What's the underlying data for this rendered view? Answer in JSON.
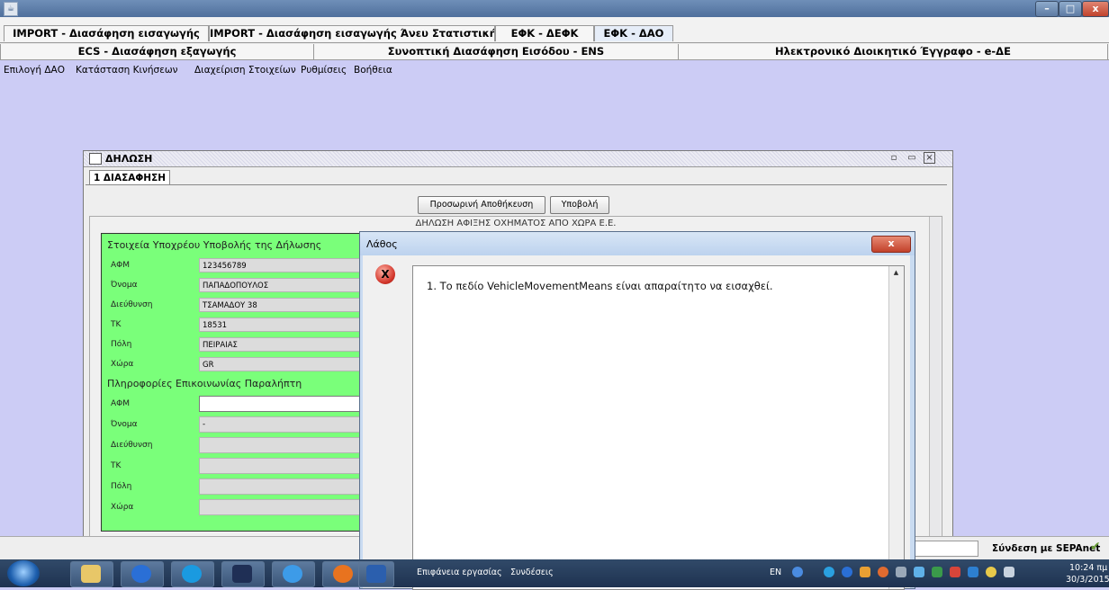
{
  "window": {
    "app_icon": "app-window-icon",
    "buttons": {
      "minimize": "–",
      "maximize": "□",
      "close": "x"
    }
  },
  "tabs_row1": [
    "IMPORT - Διασάφηση εισαγωγής",
    "IMPORT - Διασάφηση εισαγωγής Άνευ Στατιστικής",
    "ΕΦΚ - ΔΕΦΚ",
    "ΕΦΚ - ΔΑΟ"
  ],
  "tabs_row2": [
    "ECS - Διασάφηση εξαγωγής",
    "Συνοπτική Διασάφηση Εισόδου - ENS",
    "Ηλεκτρονικό Διοικητικό Έγγραφο - e-ΔΕ"
  ],
  "menu": [
    "Επιλογή ΔΑΟ",
    "Κατάσταση Κινήσεων",
    "Διαχείριση Στοιχείων",
    "Ρυθμίσεις",
    "Βοήθεια"
  ],
  "frame": {
    "title": "ΔΗΛΩΣΗ",
    "tab": "1 ΔΙΑΣΑΦΗΣΗ",
    "save_button": "Προσωρινή Αποθήκευση",
    "submit_button": "Υποβολή",
    "form_heading": "ΔΗΛΩΣΗ ΑΦΙΞΗΣ ΟΧΗΜΑΤΟΣ ΑΠΟ ΧΩΡΑ Ε.Ε."
  },
  "declarant": {
    "section": "Στοιχεία Υποχρέου Υποβολής της Δήλωσης",
    "fields": [
      {
        "label": "ΑΦΜ",
        "value": "123456789"
      },
      {
        "label": "Όνομα",
        "value": "ΠΑΠΑΔΟΠΟΥΛΟΣ"
      },
      {
        "label": "Διεύθυνση",
        "value": "ΤΣΑΜΑΔΟΥ 38"
      },
      {
        "label": "ΤΚ",
        "value": "18531"
      },
      {
        "label": "Πόλη",
        "value": "ΠΕΙΡΑΙΑΣ"
      },
      {
        "label": "Χώρα",
        "value": "GR"
      }
    ]
  },
  "recipient": {
    "section": "Πληροφορίες Επικοινωνίας Παραλήπτη",
    "fields": [
      {
        "label": "ΑΦΜ",
        "value": ""
      },
      {
        "label": "Όνομα",
        "value": "-"
      },
      {
        "label": "Διεύθυνση",
        "value": ""
      },
      {
        "label": "ΤΚ",
        "value": ""
      },
      {
        "label": "Πόλη",
        "value": ""
      },
      {
        "label": "Χώρα",
        "value": ""
      }
    ]
  },
  "dialog": {
    "title": "Λάθος",
    "close": "x",
    "error_icon": "X",
    "message": "1. Το πεδίο VehicleMovementMeans είναι απαραίτητο να εισαχθεί."
  },
  "statusbar": {
    "connection": "Σύνδεση με SEPAnet"
  },
  "taskbar": {
    "desktop": "Επιφάνεια εργασίας",
    "connections": "Συνδέσεις",
    "lang": "EN",
    "time": "10:24 πμ",
    "date": "30/3/2015"
  }
}
